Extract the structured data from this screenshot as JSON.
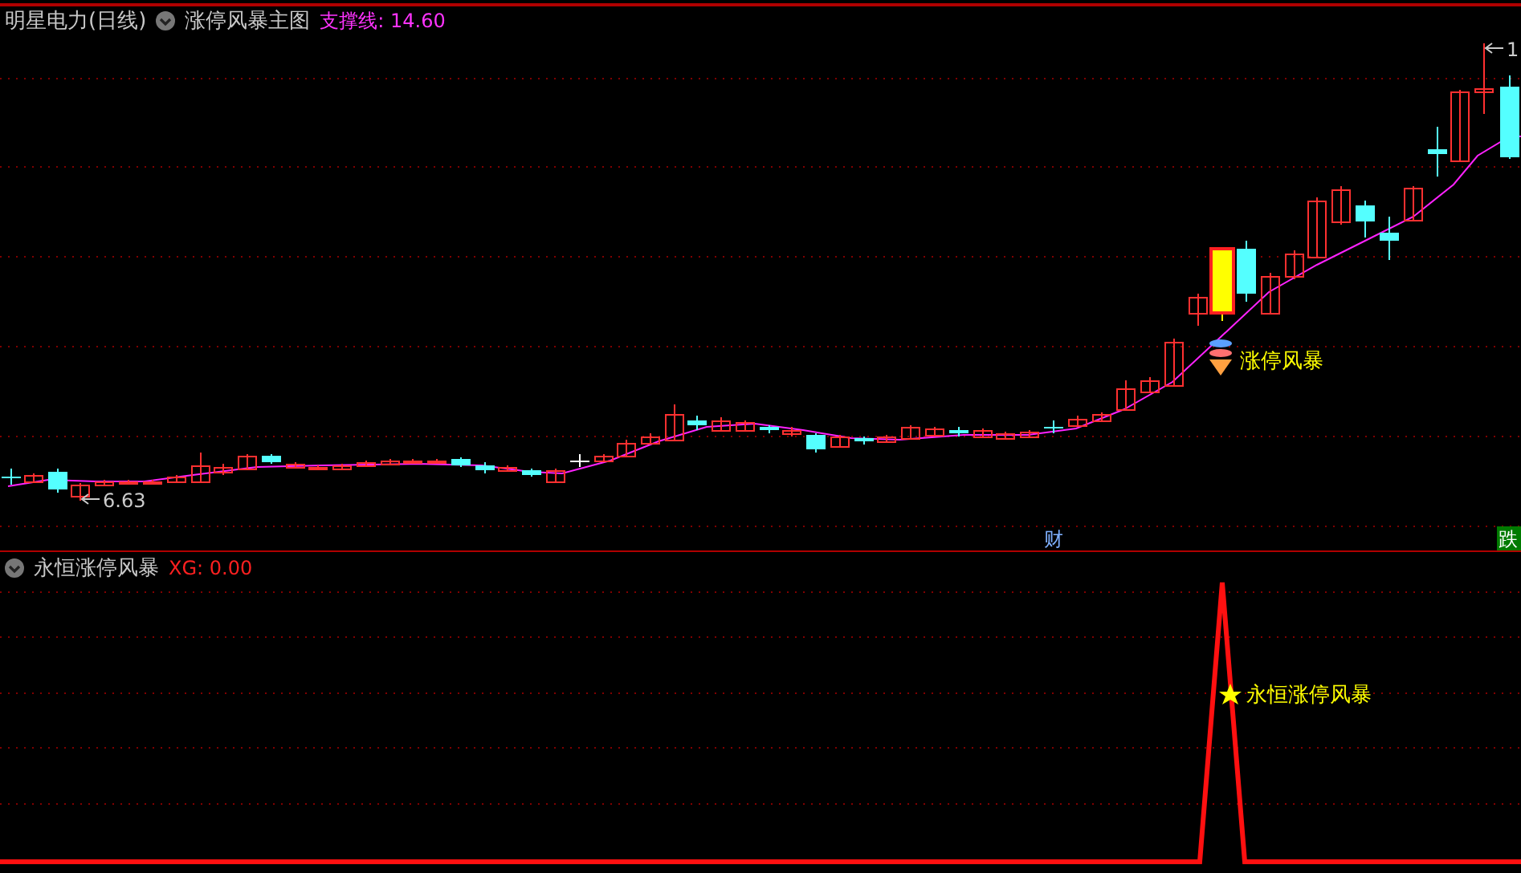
{
  "main_panel": {
    "title": "明星电力(日线)",
    "indicator": "涨停风暴主图",
    "reading": "支撑线: 14.60",
    "annotations": [
      {
        "kind": "signal",
        "text": "涨停风暴"
      },
      {
        "kind": "low",
        "text": "6.63"
      },
      {
        "kind": "high",
        "text": "1"
      }
    ],
    "markers": [
      {
        "kind": "finance",
        "text": "财"
      },
      {
        "kind": "fall",
        "text": "跌"
      }
    ]
  },
  "sub_panel": {
    "indicator": "永恒涨停风暴",
    "reading": "XG: 0.00",
    "annotation": "永恒涨停风暴"
  }
}
